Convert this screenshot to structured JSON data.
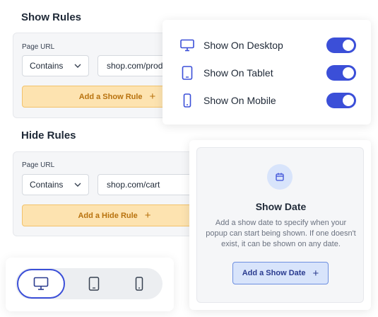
{
  "show_rules": {
    "title": "Show Rules",
    "field_label": "Page URL",
    "match_type": "Contains",
    "url_value": "shop.com/products",
    "add_button_label": "Add a Show Rule",
    "add_button_icon": "plus-icon"
  },
  "hide_rules": {
    "title": "Hide Rules",
    "field_label": "Page URL",
    "match_type": "Contains",
    "url_value": "shop.com/cart",
    "add_button_label": "Add a Hide Rule",
    "add_button_icon": "plus-icon"
  },
  "device_visibility": {
    "items": [
      {
        "label": "Show On Desktop",
        "icon": "desktop-icon",
        "enabled": true
      },
      {
        "label": "Show On Tablet",
        "icon": "tablet-icon",
        "enabled": true
      },
      {
        "label": "Show On Mobile",
        "icon": "mobile-icon",
        "enabled": true
      }
    ]
  },
  "show_date": {
    "icon": "calendar-icon",
    "title": "Show Date",
    "description": "Add a show date to specify when your popup can start being shown. If one doesn't exist, it can be shown on any date.",
    "button_label": "Add a Show Date",
    "button_icon": "plus-icon"
  },
  "device_switcher": {
    "options": [
      "desktop",
      "tablet",
      "mobile"
    ],
    "selected": "desktop"
  },
  "colors": {
    "accent": "#3b4fd8",
    "rule_button_bg": "#fde3b0",
    "rule_button_text": "#b8720e",
    "date_button_bg": "#d8e4fb"
  }
}
